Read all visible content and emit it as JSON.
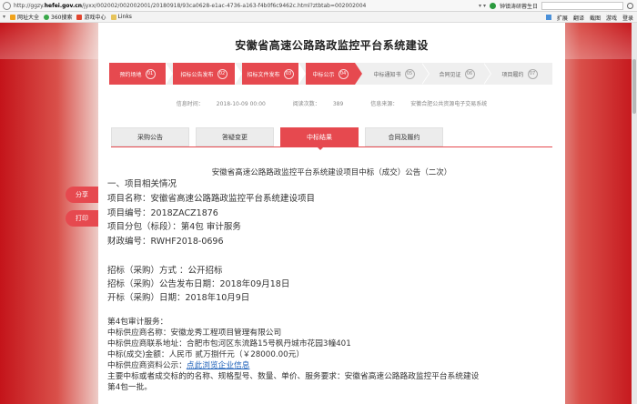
{
  "browser": {
    "url_prefix": "http://ggzy.",
    "url_domain": "hefei.gov.cn",
    "url_rest": "/jyxx/002002/002002001/20180918/93ca0628-e1ac-4736-a163-f4b0f6c9462c.html?ztbtab=002002004",
    "dropdown": "▾ ▾",
    "right_text": "钟镇涛研蓉生日",
    "search_placeholder": "",
    "bookmarks": [
      {
        "label": "网址大全",
        "icon": "favorite-icon"
      },
      {
        "label": "360搜索",
        "icon": "360-search-icon"
      },
      {
        "label": "游戏中心",
        "icon": "game-icon"
      },
      {
        "label": "Links",
        "icon": "folder-icon"
      }
    ],
    "toolbar": {
      "expand": "扩展",
      "translate": "翻译",
      "screenshot": "截图",
      "games": "游戏",
      "login": "登录"
    }
  },
  "page": {
    "title": "安徽省高速公路路政监控平台系统建设",
    "steps": [
      {
        "label": "预约场地",
        "num": "01",
        "state": "done"
      },
      {
        "label": "招标公告发布",
        "num": "02",
        "state": "done"
      },
      {
        "label": "招标文件发布",
        "num": "03",
        "state": "done"
      },
      {
        "label": "中标公示",
        "num": "04",
        "state": "active"
      },
      {
        "label": "中标通知书",
        "num": "05",
        "state": "todo"
      },
      {
        "label": "合同见证",
        "num": "06",
        "state": "todo"
      },
      {
        "label": "项目履约",
        "num": "07",
        "state": "todo"
      }
    ],
    "meta": {
      "time_label": "信息时间：",
      "time_value": "2018-10-09 00:00",
      "views_label": "阅读次数：",
      "views_value": "389",
      "source_label": "信息来源：",
      "source_value": "安徽合肥公共资源电子交易系统"
    },
    "tabs": [
      {
        "label": "采购公告",
        "active": false
      },
      {
        "label": "答疑变更",
        "active": false
      },
      {
        "label": "中标结果",
        "active": true
      },
      {
        "label": "合同及履约",
        "active": false
      }
    ],
    "side_buttons": {
      "share": "分享",
      "print": "打印"
    },
    "doc": {
      "title": "安徽省高速公路路政监控平台系统建设项目中标（成交）公告（二次）",
      "section1": "一、项目相关情况",
      "project_name": "项目名称：安徽省高速公路路政监控平台系统建设项目",
      "project_no": "项目编号：2018ZACZ1876",
      "project_lot": "项目分包（标段）：第4包 审计服务",
      "finance_no": "财政编号：RWHF2018-0696",
      "method": "招标（采购）方式 ：公开招标",
      "publish_date": "招标（采购）公告发布日期：2018年09月18日",
      "open_date": "开标（采购）日期：2018年10月9日",
      "lot_title": "第4包审计服务：",
      "winner": "中标供应商名称：安徽龙秀工程项目管理有限公司",
      "winner_addr": "中标供应商联系地址：合肥市包河区东流路15号枫丹城市花园3幢401",
      "amount": "中标(成交)金额：人民币 贰万捌仟元（￥28000.00元）",
      "info_prefix": "中标供应商资料公示：",
      "info_link": "点此浏览企业信息",
      "requirement": "主要中标或者成交标的的名称、规格型号、数量、单价、服务要求：安徽省高速公路路政监控平台系统建设",
      "lot_one": "第4包一批。"
    }
  }
}
